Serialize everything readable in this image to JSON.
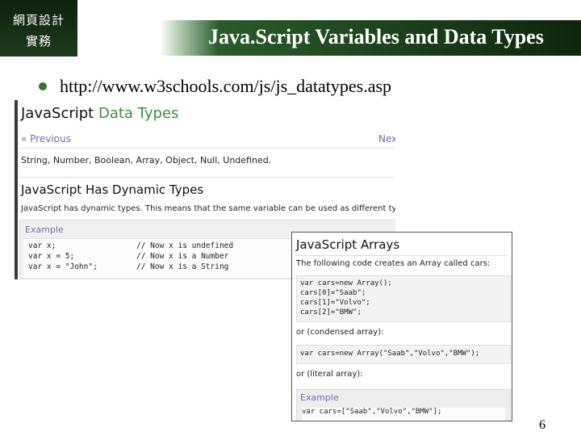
{
  "header": {
    "tag_line1": "網頁設計",
    "tag_line2": "實務",
    "title": "Java.Script Variables and Data Types"
  },
  "bullet": {
    "url": "http://www.w3schools.com/js/js_datatypes.asp"
  },
  "screenshot_datatypes": {
    "heading_part1": "JavaScript",
    "heading_part2": "Data Types",
    "nav_prev": "« Previous",
    "nav_next": "Nex",
    "types_line": "String, Number, Boolean, Array, Object, Null, Undefined.",
    "subheading": "JavaScript Has Dynamic Types",
    "description": "JavaScript has dynamic types. This means that the same variable can be used as different types:",
    "example_label": "Example",
    "code_lines": [
      {
        "code": "var x;",
        "comment": "// Now x is undefined"
      },
      {
        "code": "var x = 5;",
        "comment": "// Now x is a Number"
      },
      {
        "code": "var x = \"John\";",
        "comment": "// Now x is a String"
      }
    ]
  },
  "screenshot_arrays": {
    "heading": "JavaScript Arrays",
    "intro": "The following code creates an Array called cars:",
    "code_block1": [
      "var cars=new Array();",
      "cars[0]=\"Saab\";",
      "cars[1]=\"Volvo\";",
      "cars[2]=\"BMW\";"
    ],
    "label_condensed": "or (condensed array):",
    "code_block2": "var cars=new Array(\"Saab\",\"Volvo\",\"BMW\");",
    "label_literal": "or (literal array):",
    "example_label": "Example",
    "code_block3": "var cars=[\"Saab\",\"Volvo\",\"BMW\"];"
  },
  "page_number": "6",
  "colors": {
    "header_dark_green": "#0e250e",
    "bullet_green": "#3b6e2f",
    "w3_green": "#3f8f3f",
    "link_purple": "#7a6ab0"
  }
}
